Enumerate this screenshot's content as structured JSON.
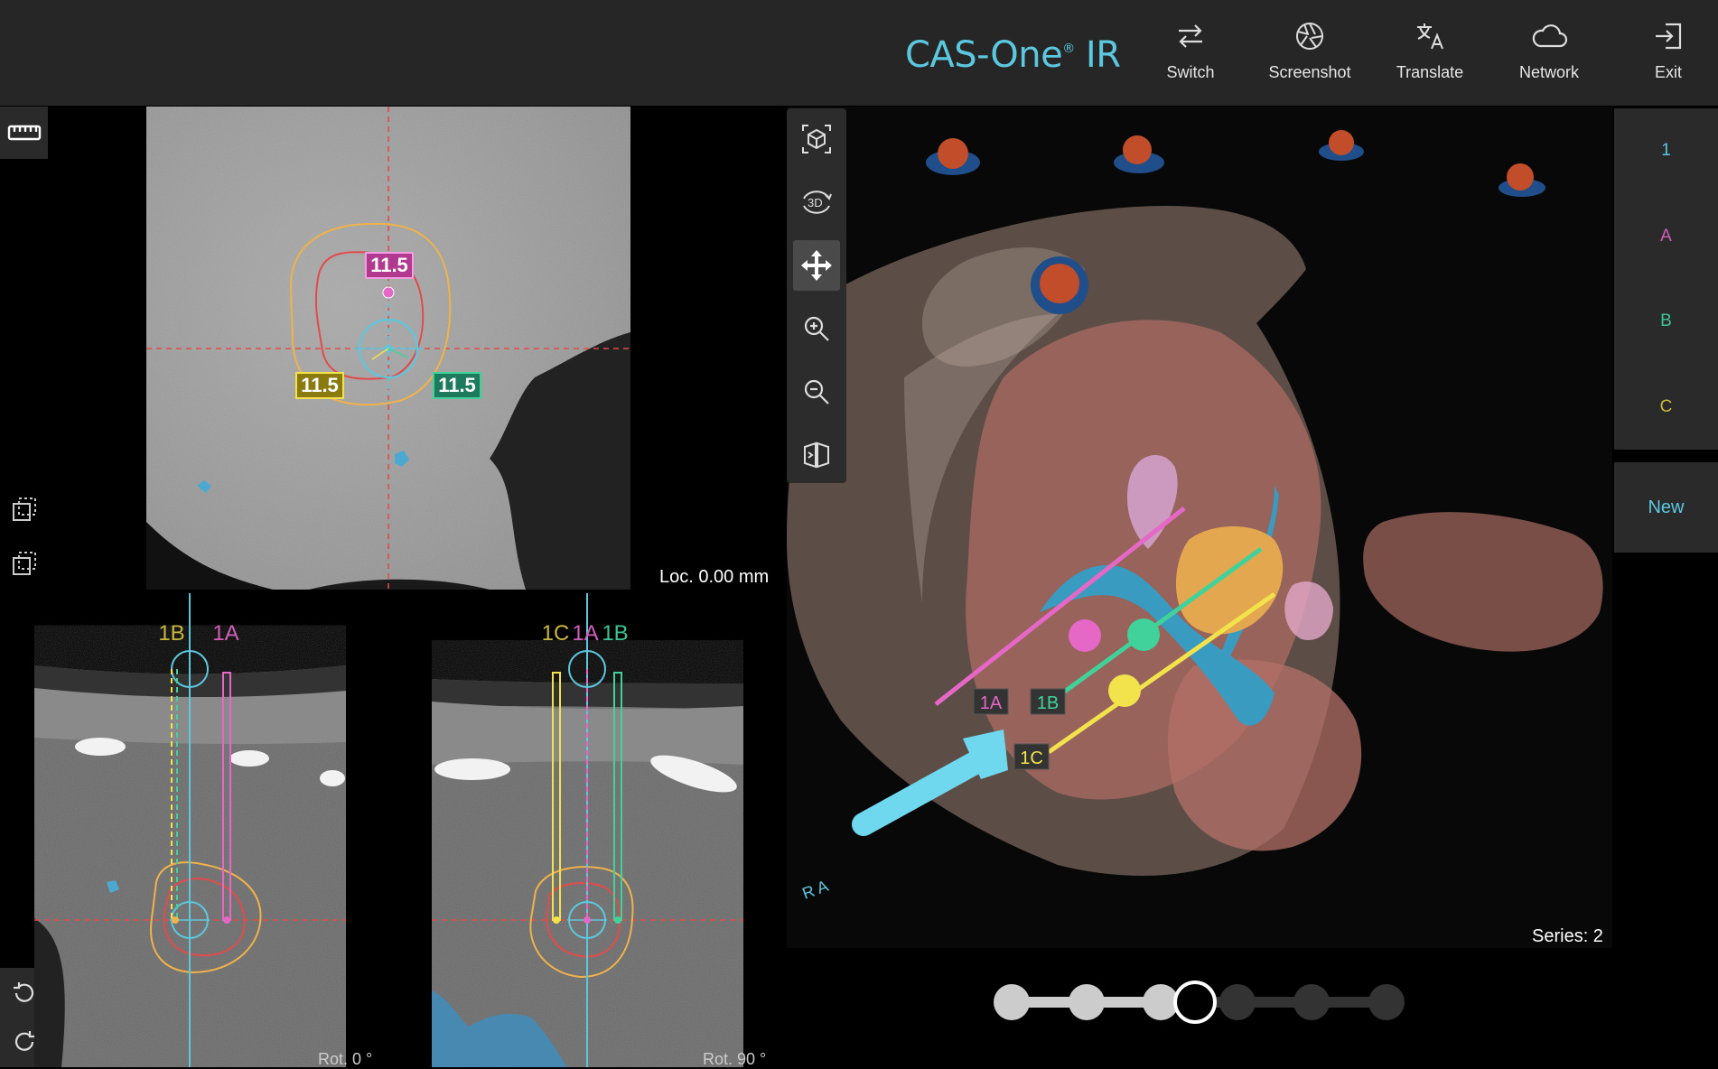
{
  "app": {
    "brand": "CAS-One",
    "brand_suffix": "IR"
  },
  "toolbar": [
    {
      "label": "Switch",
      "icon": "switch-arrows-icon"
    },
    {
      "label": "Screenshot",
      "icon": "aperture-icon"
    },
    {
      "label": "Translate",
      "icon": "translate-icon"
    },
    {
      "label": "Network",
      "icon": "cloud-icon"
    },
    {
      "label": "Exit",
      "icon": "exit-icon"
    }
  ],
  "left_tools": [
    "ruler-icon",
    "select-region-icon",
    "copy-region-icon",
    "rotate-ccw-icon",
    "rotate-cw-icon"
  ],
  "axial_view": {
    "loc": "Loc. 0.00 mm",
    "markers": {
      "pink": "11.5",
      "yellow": "11.5",
      "green": "11.5"
    }
  },
  "sagittal_view": {
    "labels": {
      "b": "1B",
      "a": "1A"
    },
    "rot": "Rot. 0 °"
  },
  "coronal_view": {
    "labels": {
      "c": "1C",
      "a": "1A",
      "b": "1B"
    },
    "rot": "Rot. 90 °"
  },
  "view3d": {
    "tools": [
      "cube-reset-icon",
      "rotate-3d-icon",
      "move-icon",
      "zoom-in-icon",
      "zoom-out-icon",
      "flip-view-icon"
    ],
    "active_tool": "move-icon",
    "needles": {
      "a": "1A",
      "b": "1B",
      "c": "1C"
    },
    "series": "Series: 2",
    "orientation": "R A"
  },
  "plan_tabs": [
    {
      "label": "1",
      "color": "#5cc8df"
    },
    {
      "label": "A",
      "color": "#d15fb8"
    },
    {
      "label": "B",
      "color": "#3cc495"
    },
    {
      "label": "C",
      "color": "#c9b83e"
    }
  ],
  "new_button": "New",
  "stepper": {
    "total": 6,
    "current": 4
  },
  "colors": {
    "accent": "#5cc8df",
    "pink": "#e567c6",
    "green": "#40d29a",
    "yellow": "#f2e24c",
    "red": "#e24b4b",
    "orange": "#f0b24a"
  }
}
